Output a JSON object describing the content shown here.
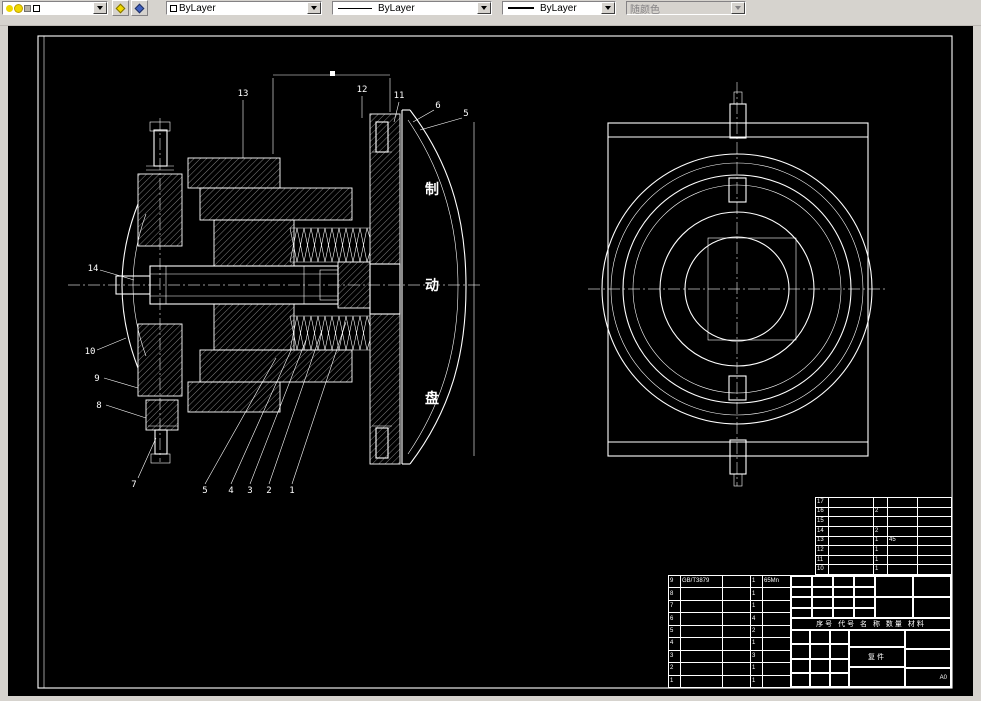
{
  "toolbar": {
    "color_value": "ByLayer",
    "linetype_value": "ByLayer",
    "lineweight_value": "ByLayer",
    "plot_style_value": "随颜色"
  },
  "drawing": {
    "disc_label": "制动盘",
    "callouts": [
      "13",
      "12",
      "11",
      "6",
      "5",
      "14",
      "10",
      "9",
      "8",
      "7",
      "5",
      "4",
      "3",
      "2",
      "1"
    ]
  },
  "tables": {
    "upper_rows": [
      [
        "17",
        "",
        "",
        "",
        ""
      ],
      [
        "16",
        "",
        "2",
        "",
        ""
      ],
      [
        "15",
        "",
        "",
        "",
        ""
      ],
      [
        "14",
        "",
        "2",
        "",
        ""
      ],
      [
        "13",
        "",
        "1",
        "45",
        ""
      ],
      [
        "12",
        "",
        "1",
        "",
        ""
      ],
      [
        "11",
        "",
        "1",
        "",
        ""
      ],
      [
        "10",
        "",
        "1",
        "",
        ""
      ]
    ],
    "lower_rows": [
      [
        "9",
        "GB/T3879",
        "",
        "1",
        "65Mn"
      ],
      [
        "8",
        "",
        "",
        "1",
        ""
      ],
      [
        "7",
        "",
        "",
        "1",
        ""
      ],
      [
        "6",
        "",
        "",
        "4",
        ""
      ],
      [
        "5",
        "",
        "",
        "2",
        ""
      ],
      [
        "4",
        "",
        "",
        "1",
        ""
      ],
      [
        "3",
        "",
        "",
        "3",
        ""
      ],
      [
        "2",
        "",
        "",
        "1",
        ""
      ],
      [
        "1",
        "",
        "",
        "1",
        ""
      ]
    ],
    "title_header": "序号 代号 名 称 数量 材料",
    "copy_label": "复件",
    "sheet_size": "A0"
  }
}
